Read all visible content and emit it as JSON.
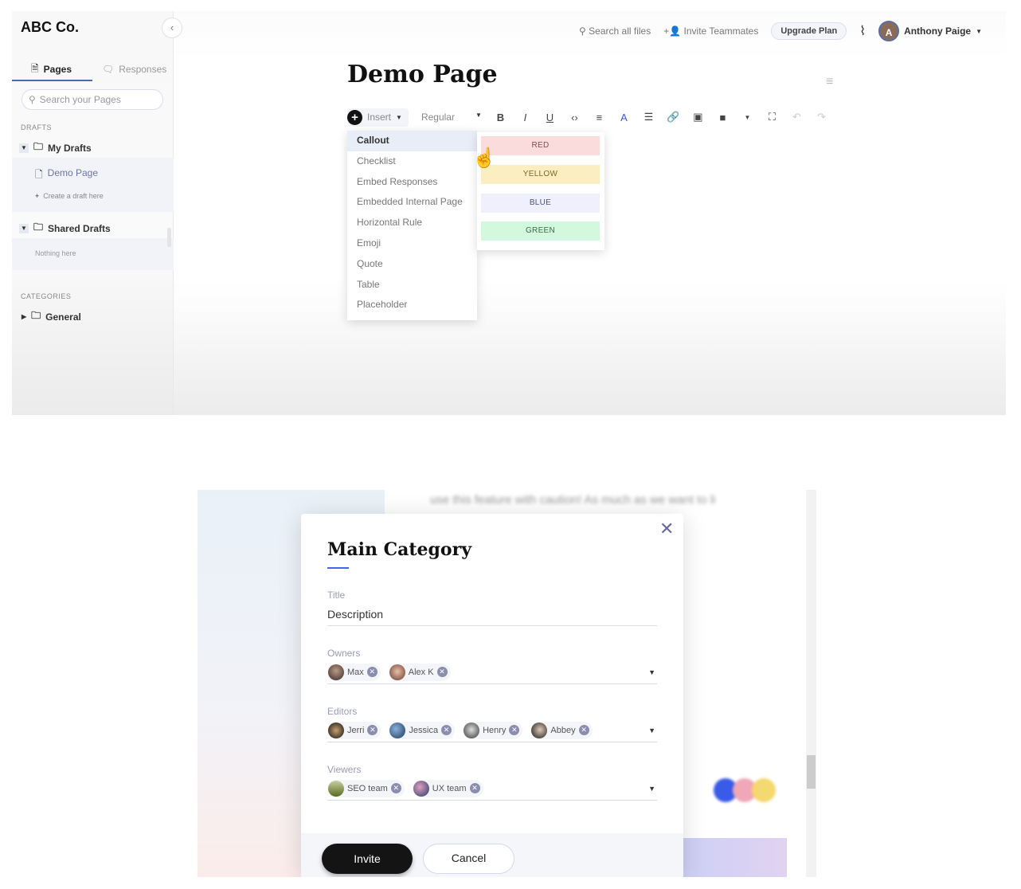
{
  "app": {
    "brand": "ABC Co."
  },
  "sidebar": {
    "tabs": [
      {
        "label": "Pages",
        "active": true
      },
      {
        "label": "Responses",
        "active": false
      }
    ],
    "search_placeholder": "Search your Pages",
    "drafts_heading": "DRAFTS",
    "my_drafts": "My Drafts",
    "demo_page": "Demo Page",
    "create_draft": "Create a draft here",
    "shared_drafts": "Shared Drafts",
    "nothing_here": "Nothing here",
    "categories_heading": "CATEGORIES",
    "general": "General"
  },
  "topbar": {
    "search": "Search all files",
    "invite": "Invite Teammates",
    "upgrade": "Upgrade Plan",
    "user_initial": "A",
    "user_name": "Anthony Paige"
  },
  "editor": {
    "title": "Demo Page",
    "insert": "Insert",
    "style": "Regular"
  },
  "insert_menu": [
    "Callout",
    "Checklist",
    "Embed Responses",
    "Embedded Internal Page",
    "Horizontal Rule",
    "Emoji",
    "Quote",
    "Table",
    "Placeholder"
  ],
  "callout_colors": [
    {
      "label": "RED",
      "bg": "#fadcdc",
      "fg": "#8a4a4a"
    },
    {
      "label": "YELLOW",
      "bg": "#fbeec0",
      "fg": "#7a6a2a"
    },
    {
      "label": "BLUE",
      "bg": "#eff0fb",
      "fg": "#4a4f7a"
    },
    {
      "label": "GREEN",
      "bg": "#d4f8de",
      "fg": "#3a6a48"
    }
  ],
  "background_text": "use this feature with caution! As much as we want to li",
  "modal": {
    "title": "Main Category",
    "title_label": "Title",
    "title_value": "Description",
    "owners_label": "Owners",
    "owners": [
      "Max",
      "Alex K"
    ],
    "editors_label": "Editors",
    "editors": [
      "Jerri",
      "Jessica",
      "Henry",
      "Abbey"
    ],
    "viewers_label": "Viewers",
    "viewers": [
      "SEO team",
      "UX team"
    ],
    "invite": "Invite",
    "cancel": "Cancel"
  },
  "colors": {
    "accent": "#4a64e8",
    "primary_button": "#141414"
  }
}
